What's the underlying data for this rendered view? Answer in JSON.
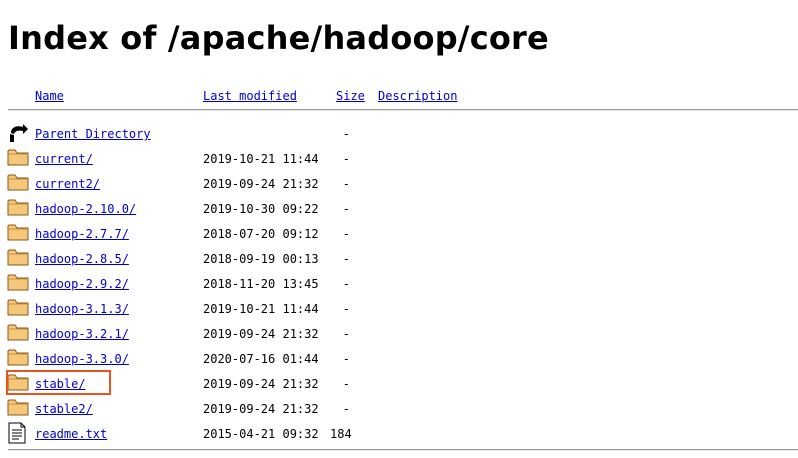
{
  "page": {
    "title": "Index of /apache/hadoop/core"
  },
  "table": {
    "headers": {
      "name": "Name",
      "last_modified": "Last modified",
      "size": "Size",
      "description": "Description"
    },
    "parent": {
      "label": "Parent Directory",
      "size": "-"
    },
    "rows": [
      {
        "name": "current/",
        "date": "2019-10-21 11:44",
        "size": "-",
        "icon": "folder-icon"
      },
      {
        "name": "current2/",
        "date": "2019-09-24 21:32",
        "size": "-",
        "icon": "folder-icon"
      },
      {
        "name": "hadoop-2.10.0/",
        "date": "2019-10-30 09:22",
        "size": "-",
        "icon": "folder-icon"
      },
      {
        "name": "hadoop-2.7.7/",
        "date": "2018-07-20 09:12",
        "size": "-",
        "icon": "folder-icon"
      },
      {
        "name": "hadoop-2.8.5/",
        "date": "2018-09-19 00:13",
        "size": "-",
        "icon": "folder-icon"
      },
      {
        "name": "hadoop-2.9.2/",
        "date": "2018-11-20 13:45",
        "size": "-",
        "icon": "folder-icon"
      },
      {
        "name": "hadoop-3.1.3/",
        "date": "2019-10-21 11:44",
        "size": "-",
        "icon": "folder-icon"
      },
      {
        "name": "hadoop-3.2.1/",
        "date": "2019-09-24 21:32",
        "size": "-",
        "icon": "folder-icon"
      },
      {
        "name": "hadoop-3.3.0/",
        "date": "2020-07-16 01:44",
        "size": "-",
        "icon": "folder-icon"
      },
      {
        "name": "stable/",
        "date": "2019-09-24 21:32",
        "size": "-",
        "icon": "folder-icon"
      },
      {
        "name": "stable2/",
        "date": "2019-09-24 21:32",
        "size": "-",
        "icon": "folder-icon"
      },
      {
        "name": "readme.txt",
        "date": "2015-04-21 09:32",
        "size": "184",
        "icon": "text-file-icon"
      }
    ]
  },
  "colors": {
    "link": "#0000cc",
    "highlight": "#e8541e",
    "folder": "#e8b25a"
  }
}
